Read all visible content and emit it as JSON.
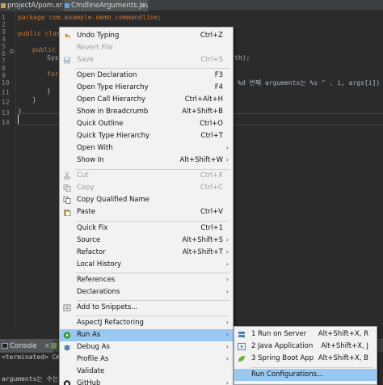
{
  "tabs": [
    {
      "label": "projectA/pom.xml"
    },
    {
      "label": "CmdlineArguments.java"
    }
  ],
  "editor": {
    "line_numbers": [
      "1",
      "2",
      "3",
      "4",
      "5",
      "6",
      "7",
      "8",
      "9",
      "10",
      "11",
      "12",
      "13",
      "14"
    ],
    "lines": {
      "package": "package com.example.demo.commandline;",
      "public_class": "public clas",
      "public_method": "public",
      "sys": "Sys",
      "println_tail": "th);",
      "for_kw": "for",
      "format_tail": "%d 번째 arguments는 %s \" , i, args[i]) );",
      "close_brace_inner": "}",
      "close_brace_outer": "}",
      "close_brace_class": "}"
    }
  },
  "context_menu": {
    "items": [
      {
        "label": "Undo Typing",
        "shortcut": "Ctrl+Z",
        "icon": "undo-icon",
        "disabled": false
      },
      {
        "label": "Revert File",
        "shortcut": "",
        "disabled": true
      },
      {
        "label": "Save",
        "shortcut": "Ctrl+S",
        "icon": "save-icon",
        "disabled": true
      },
      {
        "label": "Open Declaration",
        "shortcut": "F3",
        "disabled": false
      },
      {
        "label": "Open Type Hierarchy",
        "shortcut": "F4",
        "disabled": false
      },
      {
        "label": "Open Call Hierarchy",
        "shortcut": "Ctrl+Alt+H",
        "disabled": false
      },
      {
        "label": "Show in Breadcrumb",
        "shortcut": "Alt+Shift+B",
        "disabled": false
      },
      {
        "label": "Quick Outline",
        "shortcut": "Ctrl+O",
        "disabled": false
      },
      {
        "label": "Quick Type Hierarchy",
        "shortcut": "Ctrl+T",
        "disabled": false
      },
      {
        "label": "Open With",
        "shortcut": "",
        "submenu": true,
        "disabled": false
      },
      {
        "label": "Show In",
        "shortcut": "Alt+Shift+W",
        "submenu": true,
        "disabled": false
      },
      {
        "label": "Cut",
        "shortcut": "Ctrl+X",
        "icon": "cut-icon",
        "disabled": true
      },
      {
        "label": "Copy",
        "shortcut": "Ctrl+C",
        "icon": "copy-icon",
        "disabled": true
      },
      {
        "label": "Copy Qualified Name",
        "shortcut": "",
        "icon": "copy-qualified-name-icon",
        "disabled": false
      },
      {
        "label": "Paste",
        "shortcut": "Ctrl+V",
        "icon": "paste-icon",
        "disabled": false
      },
      {
        "label": "Quick Fix",
        "shortcut": "Ctrl+1",
        "disabled": false
      },
      {
        "label": "Source",
        "shortcut": "Alt+Shift+S",
        "submenu": true,
        "disabled": false
      },
      {
        "label": "Refactor",
        "shortcut": "Alt+Shift+T",
        "submenu": true,
        "disabled": false
      },
      {
        "label": "Local History",
        "shortcut": "",
        "submenu": true,
        "disabled": false
      },
      {
        "label": "References",
        "shortcut": "",
        "submenu": true,
        "disabled": false
      },
      {
        "label": "Declarations",
        "shortcut": "",
        "submenu": true,
        "disabled": false
      },
      {
        "label": "Add to Snippets...",
        "shortcut": "",
        "icon": "snippets-icon",
        "disabled": false
      },
      {
        "label": "AspectJ Refactoring",
        "shortcut": "",
        "submenu": true,
        "disabled": false
      },
      {
        "label": "Run As",
        "shortcut": "",
        "submenu": true,
        "icon": "run-icon",
        "highlighted": true,
        "disabled": false
      },
      {
        "label": "Debug As",
        "shortcut": "",
        "submenu": true,
        "icon": "debug-icon",
        "disabled": false
      },
      {
        "label": "Profile As",
        "shortcut": "",
        "submenu": true,
        "disabled": false
      },
      {
        "label": "Validate",
        "shortcut": "",
        "disabled": false
      },
      {
        "label": "GitHub",
        "shortcut": "",
        "submenu": true,
        "icon": "github-icon",
        "disabled": false
      }
    ],
    "arrow_glyph": "›"
  },
  "run_as_submenu": {
    "items": [
      {
        "label": "1 Run on Server",
        "shortcut": "Alt+Shift+X, R",
        "icon": "server-icon"
      },
      {
        "label": "2 Java Application",
        "shortcut": "Alt+Shift+X, J",
        "icon": "java-app-icon"
      },
      {
        "label": "3 Spring Boot App",
        "shortcut": "Alt+Shift+X, B",
        "icon": "spring-boot-icon"
      },
      {
        "label": "Run Configurations...",
        "shortcut": "",
        "highlighted": true
      }
    ]
  },
  "bottom_panel": {
    "console_tab": "Console",
    "terminated_text": "<terminated> Cmdlin",
    "output_text": "arguments는 수는 ="
  },
  "colors": {
    "menu_bg": "#f2f2f2",
    "highlight": "#99c9f2",
    "editor_bg": "#2b2b2b",
    "keyword": "#cc7832",
    "disabled_text": "#9c9c9c"
  }
}
